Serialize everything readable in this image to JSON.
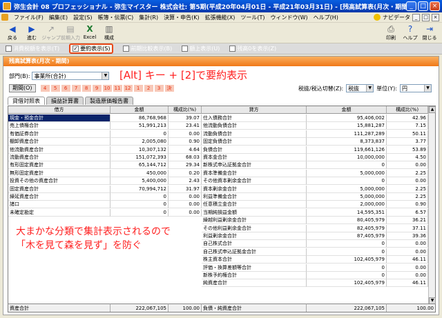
{
  "window": {
    "title": "弥生会計 08 プロフェッショナル - 弥生マイスター 株式会社: 第5期(平成20年04月01日 - 平成21年03月31日) - [残高試算表(月次・期間)]",
    "minimize": "_",
    "maximize": "□",
    "close": "×"
  },
  "menu": {
    "items": [
      "ファイル(F)",
      "編集(E)",
      "設定(S)",
      "帳簿・伝票(C)",
      "集計(R)",
      "決算・申告(K)",
      "拡張機能(X)",
      "ツール(T)",
      "ウィンドウ(W)",
      "ヘルプ(H)"
    ],
    "navi": "ナビデータ"
  },
  "toolbar": {
    "back": "戻る",
    "forward": "進む",
    "jump": "ジャンプ",
    "detail": "前期入力",
    "excel": "Excel",
    "config": "構成",
    "print": "印刷",
    "help": "ヘルプ",
    "close": "閉じる"
  },
  "options": {
    "tax_display": "消費税額を表示(T)",
    "summary_display": "要約表示(S)",
    "prev_compare": "前期比較表示(B)",
    "show_upper": "額上表示(U)",
    "show_zero": "残高0を表示(Z)"
  },
  "panel": {
    "title": "残高試算表(月次・期間)",
    "dept_label": "部門(B):",
    "dept_value": "事業所(合計)",
    "period_button": "期間(O)",
    "months": [
      "4",
      "5",
      "6",
      "7",
      "8",
      "9",
      "10",
      "11",
      "12",
      "1",
      "2",
      "3",
      "決"
    ],
    "tax_label": "税抜/税込切替(Z):",
    "tax_value": "税抜",
    "unit_label": "単位(Y):",
    "unit_value": "円",
    "tabs": [
      "貸借対照表",
      "損益計算書",
      "製造原価報告書"
    ]
  },
  "annotations": {
    "top": "[Alt] キー + [2]で要約表示",
    "bottom_line1": "大まかな分類で集計表示されるので",
    "bottom_line2": "「木を見て森を見ず」を防ぐ"
  },
  "table": {
    "headers": {
      "debit": "借方",
      "amount": "金額",
      "ratio": "構成比(%)",
      "credit": "貸方"
    },
    "left_rows": [
      {
        "name": "現金・預金合計",
        "amount": "86,768,968",
        "ratio": "39.07"
      },
      {
        "name": "売上債権合計",
        "amount": "51,991,213",
        "ratio": "23.41"
      },
      {
        "name": "有価証券合計",
        "amount": "0",
        "ratio": "0.00"
      },
      {
        "name": "棚卸資産合計",
        "amount": "2,005,080",
        "ratio": "0.90"
      },
      {
        "name": "他流動資産合計",
        "amount": "10,307,132",
        "ratio": "4.64"
      },
      {
        "name": "流動資産合計",
        "amount": "151,072,393",
        "ratio": "68.03"
      },
      {
        "name": "有形固定資産計",
        "amount": "65,144,712",
        "ratio": "29.34"
      },
      {
        "name": "無形固定資産計",
        "amount": "450,000",
        "ratio": "0.20"
      },
      {
        "name": "投資その他の資産合計",
        "amount": "5,400,000",
        "ratio": "2.43"
      },
      {
        "name": "固定資産合計",
        "amount": "70,994,712",
        "ratio": "31.97"
      },
      {
        "name": "繰延資産合計",
        "amount": "0",
        "ratio": "0.00"
      },
      {
        "name": "諸口",
        "amount": "0",
        "ratio": "0.00"
      },
      {
        "name": "未確定勘定",
        "amount": "0",
        "ratio": "0.00"
      }
    ],
    "right_rows": [
      {
        "name": "仕入債務合計",
        "amount": "95,406,002",
        "ratio": "42.96"
      },
      {
        "name": "他流動負債合計",
        "amount": "15,881,287",
        "ratio": "7.15"
      },
      {
        "name": "流動負債合計",
        "amount": "111,287,289",
        "ratio": "50.11"
      },
      {
        "name": "固定負債合計",
        "amount": "8,373,837",
        "ratio": "3.77"
      },
      {
        "name": "負債合計",
        "amount": "119,661,126",
        "ratio": "53.89"
      },
      {
        "name": "資本金合計",
        "amount": "10,000,000",
        "ratio": "4.50"
      },
      {
        "name": "新株式申込証拠金合計",
        "amount": "0",
        "ratio": "0.00"
      },
      {
        "name": "資本準備金合計",
        "amount": "5,000,000",
        "ratio": "2.25"
      },
      {
        "name": "その他資本剰余金合計",
        "amount": "0",
        "ratio": "0.00"
      },
      {
        "name": "資本剰余金合計",
        "amount": "5,000,000",
        "ratio": "2.25"
      },
      {
        "name": "利益準備金合計",
        "amount": "5,000,000",
        "ratio": "2.25"
      },
      {
        "name": "任意積立金合計",
        "amount": "2,000,000",
        "ratio": "0.90"
      },
      {
        "name": "当期純損益金額",
        "amount": "14,595,351",
        "ratio": "6.57"
      },
      {
        "name": "繰越利益剰余金合計",
        "amount": "80,405,979",
        "ratio": "36.21"
      },
      {
        "name": "その他利益剰余金合計",
        "amount": "82,405,979",
        "ratio": "37.11"
      },
      {
        "name": "利益剰余金合計",
        "amount": "87,405,979",
        "ratio": "39.36"
      },
      {
        "name": "自己株式合計",
        "amount": "0",
        "ratio": "0.00"
      },
      {
        "name": "自己株式申込証拠金合計",
        "amount": "0",
        "ratio": "0.00"
      },
      {
        "name": "株主資本合計",
        "amount": "102,405,979",
        "ratio": "46.11"
      },
      {
        "name": "評価・換算差額等合計",
        "amount": "0",
        "ratio": "0.00"
      },
      {
        "name": "新株予約権合計",
        "amount": "0",
        "ratio": "0.00"
      },
      {
        "name": "純資産合計",
        "amount": "102,405,979",
        "ratio": "46.11"
      }
    ],
    "footer_left": {
      "name": "資産合計",
      "amount": "222,067,105",
      "ratio": "100.00"
    },
    "footer_right": {
      "name": "負債・純資産合計",
      "amount": "222,067,105",
      "ratio": "100.00"
    }
  }
}
